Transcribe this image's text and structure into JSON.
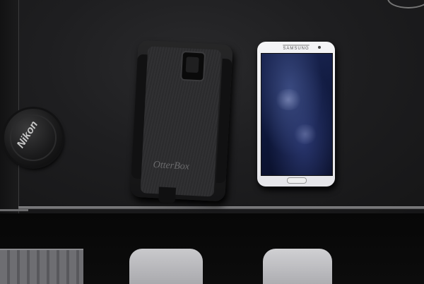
{
  "scene": {
    "description_labels": {
      "lens_cap_brand": "Nikon",
      "case_brand": "OtterBox",
      "phone_brand": "SAMSUNG"
    },
    "colors": {
      "table": "#1e1e20",
      "phone_body": "#f0f0f2",
      "phone_screen": "#1a2552",
      "case": "#232325"
    }
  }
}
